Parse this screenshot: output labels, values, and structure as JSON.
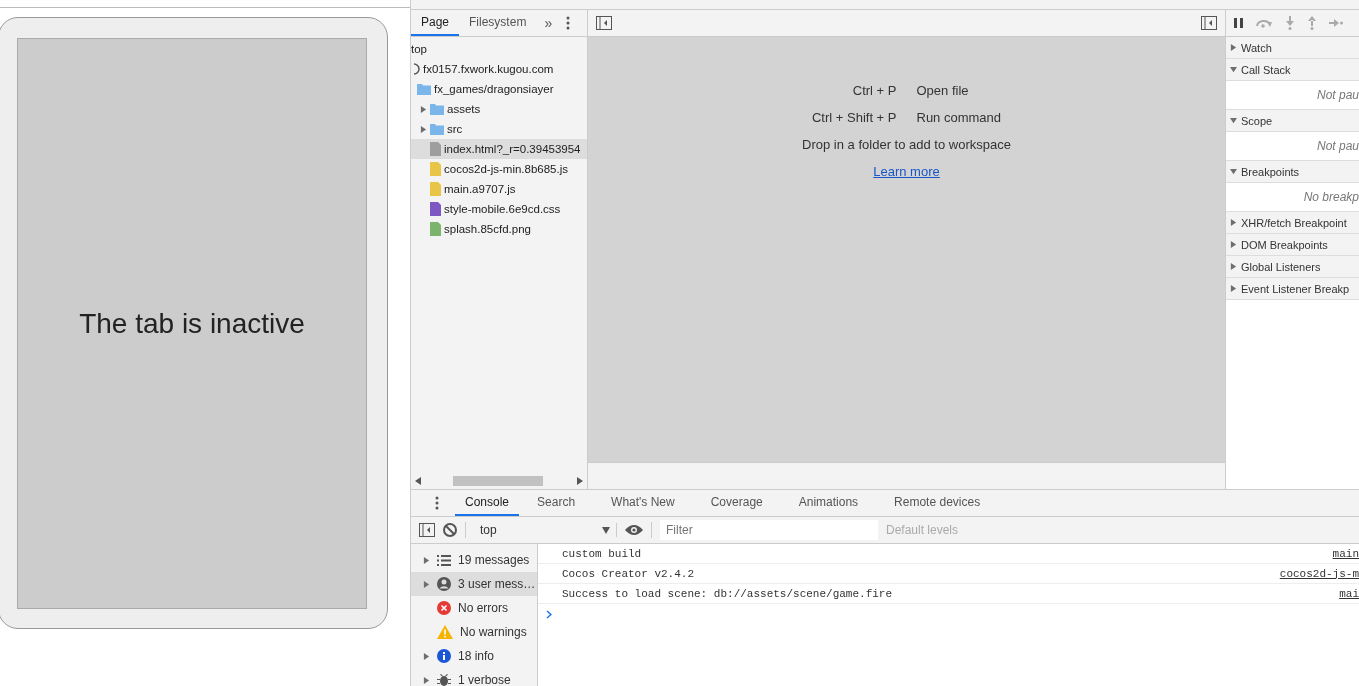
{
  "preview": {
    "message": "The tab is inactive"
  },
  "navigator": {
    "tabs": [
      {
        "label": "Page",
        "selected": true
      },
      {
        "label": "Filesystem",
        "selected": false
      }
    ],
    "more": "»",
    "tree": [
      {
        "label": "top",
        "children": [
          {
            "label": "fx0157.fxwork.kugou.com",
            "kind": "origin",
            "children": [
              {
                "label": "fx_games/dragonsiayer",
                "kind": "folder",
                "children": [
                  {
                    "label": "assets",
                    "kind": "folder",
                    "expanded": false
                  },
                  {
                    "label": "src",
                    "kind": "folder",
                    "expanded": false
                  },
                  {
                    "label": "index.html?_r=0.39453954",
                    "kind": "file",
                    "color": "#9e9e9e",
                    "selected": true
                  },
                  {
                    "label": "cocos2d-js-min.8b685.js",
                    "kind": "file",
                    "color": "#e8c547",
                    "selected": false
                  },
                  {
                    "label": "main.a9707.js",
                    "kind": "file",
                    "color": "#e8c547",
                    "selected": false
                  },
                  {
                    "label": "style-mobile.6e9cd.css",
                    "kind": "file",
                    "color": "#7e57c2",
                    "selected": false
                  },
                  {
                    "label": "splash.85cfd.png",
                    "kind": "file",
                    "color": "#7cb36d",
                    "selected": false
                  }
                ]
              }
            ]
          }
        ]
      }
    ]
  },
  "editor": {
    "shortcuts": [
      {
        "keys": "Ctrl + P",
        "action": "Open file"
      },
      {
        "keys": "Ctrl + Shift + P",
        "action": "Run command"
      }
    ],
    "hint": "Drop in a folder to add to workspace",
    "link": "Learn more"
  },
  "debugger": {
    "sections": [
      {
        "title": "Watch",
        "expanded": false
      },
      {
        "title": "Call Stack",
        "expanded": true,
        "message": "Not pau"
      },
      {
        "title": "Scope",
        "expanded": true,
        "message": "Not pau"
      },
      {
        "title": "Breakpoints",
        "expanded": true,
        "message": "No breakp"
      },
      {
        "title": "XHR/fetch Breakpoint",
        "expanded": false
      },
      {
        "title": "DOM Breakpoints",
        "expanded": false
      },
      {
        "title": "Global Listeners",
        "expanded": false
      },
      {
        "title": "Event Listener Breakp",
        "expanded": false
      }
    ]
  },
  "drawer": {
    "tabs": [
      {
        "label": "Console",
        "selected": true
      },
      {
        "label": "Search",
        "selected": false
      },
      {
        "label": "What's New",
        "selected": false
      },
      {
        "label": "Coverage",
        "selected": false
      },
      {
        "label": "Animations",
        "selected": false
      },
      {
        "label": "Remote devices",
        "selected": false
      }
    ],
    "context": "top",
    "filter": {
      "placeholder": "Filter"
    },
    "levels": "Default levels",
    "sidebar": [
      {
        "label": "19 messages",
        "kind": "messages",
        "expanded": false,
        "selected": false
      },
      {
        "label": "3 user mess…",
        "kind": "user",
        "expanded": false,
        "selected": true
      },
      {
        "label": "No errors",
        "kind": "error",
        "selected": false
      },
      {
        "label": "No warnings",
        "kind": "warning",
        "selected": false
      },
      {
        "label": "18 info",
        "kind": "info",
        "expanded": false,
        "selected": false
      },
      {
        "label": "1 verbose",
        "kind": "verbose",
        "expanded": false,
        "selected": false
      }
    ],
    "messages": [
      {
        "text": "custom build",
        "source": "main"
      },
      {
        "text": "Cocos Creator v2.4.2",
        "source": "cocos2d-js-m"
      },
      {
        "text": "Success to load scene: db://assets/scene/game.fire",
        "source": "mai"
      }
    ]
  }
}
